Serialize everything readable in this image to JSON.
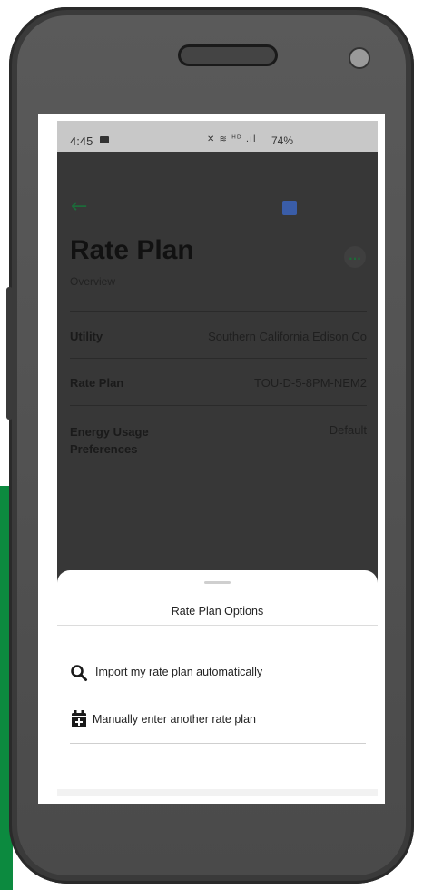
{
  "status": {
    "time": "4:45",
    "battery": "74%",
    "icons": "✕ ≋ ᴴᴰ .ıl"
  },
  "page": {
    "title": "Rate Plan",
    "subtitle": "Overview",
    "more_icon": "...",
    "rows": [
      {
        "label": "Utility",
        "value": "Southern California Edison Co"
      },
      {
        "label": "Rate Plan",
        "value": "TOU-D-5-8PM-NEM2"
      },
      {
        "label": "Energy Usage Preferences",
        "value": "Default"
      }
    ]
  },
  "sheet": {
    "title": "Rate Plan Options",
    "options": [
      {
        "label": "Import my rate plan automatically",
        "icon": "search-icon"
      },
      {
        "label": "Manually enter another rate plan",
        "icon": "calendar-add-icon"
      }
    ]
  },
  "navbar": {
    "recent_icon": "|||",
    "back_icon": "‹"
  },
  "colors": {
    "accent_green": "#0c8a3f",
    "statusbar": "#c8c8c8",
    "overlay": "#373737"
  }
}
